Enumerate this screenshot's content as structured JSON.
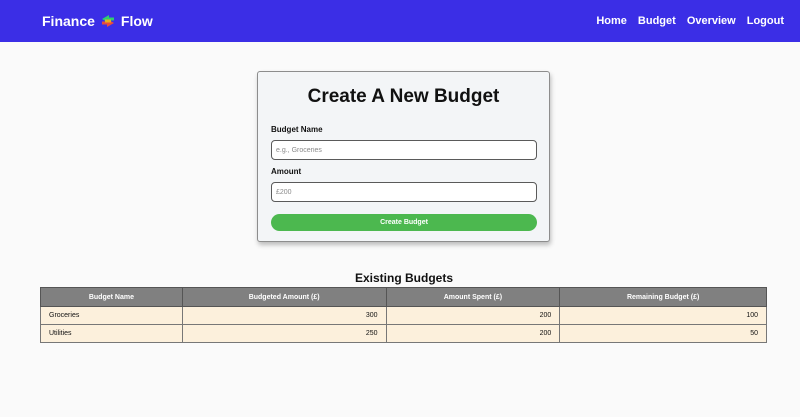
{
  "nav": {
    "brand_left": "Finance",
    "brand_right": "Flow",
    "links": [
      "Home",
      "Budget",
      "Overview",
      "Logout"
    ]
  },
  "form": {
    "title": "Create A New Budget",
    "name_label": "Budget Name",
    "name_placeholder": "e.g., Groceries",
    "amount_label": "Amount",
    "amount_placeholder": "£200",
    "submit_label": "Create Budget"
  },
  "table": {
    "title": "Existing Budgets",
    "headers": [
      "Budget Name",
      "Budgeted Amount (£)",
      "Amount Spent (£)",
      "Remaining Budget (£)"
    ],
    "rows": [
      [
        "Groceries",
        "300",
        "200",
        "100"
      ],
      [
        "Utilities",
        "250",
        "200",
        "50"
      ]
    ]
  },
  "colors": {
    "navbar": "#3b2ee6",
    "button": "#4cb84f",
    "table_header": "#808080",
    "table_row": "#fcf0dc"
  },
  "icons": {
    "brand": "exchange-arrows-icon"
  }
}
